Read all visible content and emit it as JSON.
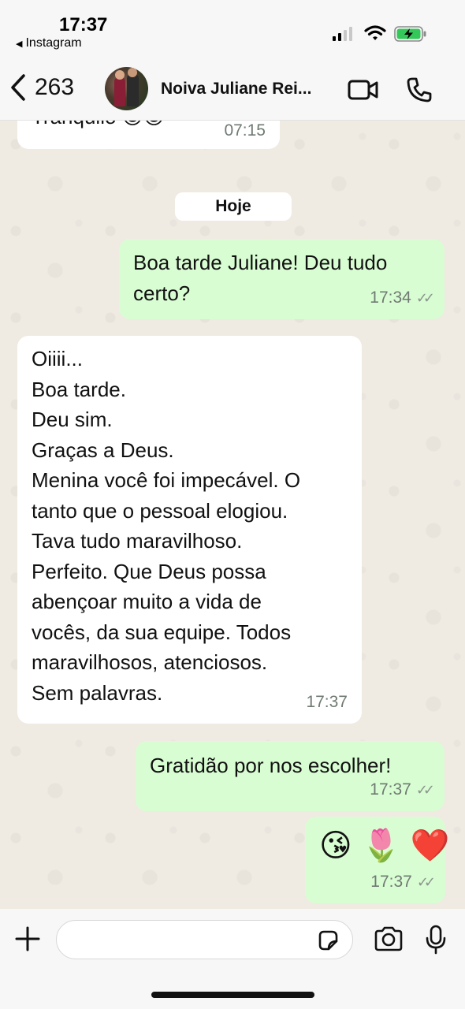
{
  "status_bar": {
    "time": "17:37",
    "back_app": "Instagram",
    "back_arrow": "◀"
  },
  "header": {
    "back_count": "263",
    "contact_name": "Noiva Juliane Rei...",
    "icons": [
      "chevron-left-icon",
      "video-call-icon",
      "phone-icon"
    ]
  },
  "chat": {
    "date_separator": "Hoje",
    "messages": [
      {
        "direction": "incoming",
        "text": "Tranquilo 😊😊",
        "time": "07:15"
      },
      {
        "direction": "outgoing",
        "lines": [
          "Boa tarde Juliane! Deu tudo",
          "certo?"
        ],
        "time": "17:34",
        "status": "read"
      },
      {
        "direction": "incoming",
        "lines": [
          "Oiiii...",
          "Boa tarde.",
          "Deu sim.",
          "Graças a Deus.",
          "Menina você foi impecável. O",
          "tanto que o pessoal elogiou.",
          "Tava tudo maravilhoso.",
          "Perfeito. Que Deus possa",
          "abençoar muito a vida de",
          "vocês, da sua equipe. Todos",
          "maravilhosos, atenciosos.",
          "Sem palavras."
        ],
        "time": "17:37"
      },
      {
        "direction": "outgoing",
        "text": "Gratidão por nos escolher!",
        "time": "17:37",
        "status": "read"
      },
      {
        "direction": "outgoing",
        "emojis": [
          "😘",
          "🌷",
          "❤️"
        ],
        "time": "17:37",
        "status": "read"
      }
    ],
    "read_ticks": "✓✓"
  },
  "input_bar": {
    "placeholder": "",
    "icons": [
      "plus-icon",
      "sticker-icon",
      "camera-icon",
      "microphone-icon"
    ]
  },
  "colors": {
    "outgoing_bubble": "#d9fdd3",
    "incoming_bubble": "#ffffff",
    "chat_background": "#efeae2",
    "battery_green": "#34c759"
  }
}
